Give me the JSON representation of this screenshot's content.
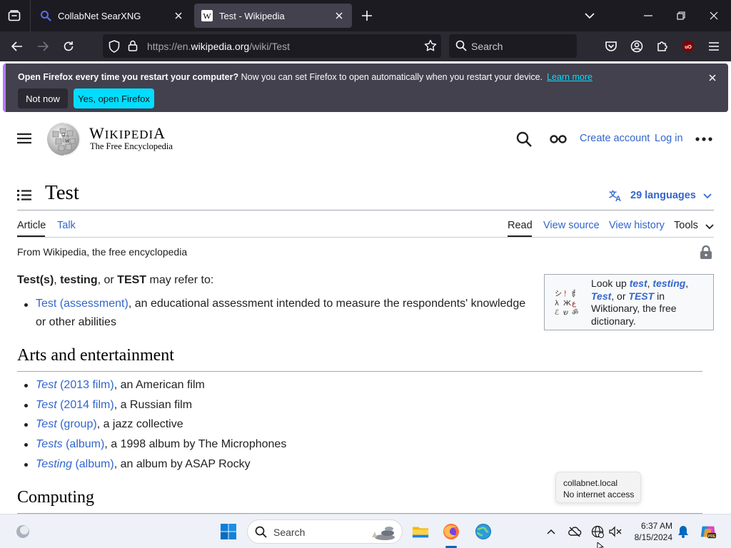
{
  "browser": {
    "tabs": [
      {
        "title": "CollabNet SearXNG",
        "active": false
      },
      {
        "title": "Test - Wikipedia",
        "active": true
      }
    ],
    "url_prefix": "https://en.",
    "url_host": "wikipedia.org",
    "url_path": "/wiki/Test",
    "search_placeholder": "Search"
  },
  "notification": {
    "bold_text": "Open Firefox every time you restart your computer?",
    "text": " Now you can set Firefox to open automatically when you restart your device.",
    "learn_more": "Learn more",
    "not_now": "Not now",
    "yes_open": "Yes, open Firefox"
  },
  "wiki": {
    "wordmark_w": "W",
    "wordmark_rest": "IKIPEDI",
    "wordmark_a": "A",
    "tagline": "The Free Encyclopedia",
    "create_account": "Create account",
    "log_in": "Log in",
    "page_title": "Test",
    "languages": "29 languages",
    "tabs": {
      "article": "Article",
      "talk": "Talk",
      "read": "Read",
      "view_source": "View source",
      "view_history": "View history",
      "tools": "Tools"
    },
    "from_text": "From Wikipedia, the free encyclopedia",
    "lead": {
      "t1": "Test(s)",
      "sep1": ", ",
      "t2": "testing",
      "sep2": ", or ",
      "t3": "TEST",
      "rest": " may refer to:"
    },
    "wiktionary": {
      "pre": "Look up ",
      "w1": "test",
      "c1": ", ",
      "w2": "testing",
      "c2": ", ",
      "w3": "Test",
      "c3": ", or ",
      "w4": "TEST",
      "post": " in Wiktionary, the free dictionary."
    },
    "intro_item": {
      "link": "Test (assessment)",
      "text": ", an educational assessment intended to measure the respondents' knowledge",
      "line2": "or other abilities"
    },
    "section1": "Arts and entertainment",
    "arts_items": [
      {
        "italic": "Test",
        "paren": " (2013 film)",
        "text": ", an American film"
      },
      {
        "italic": "Test",
        "paren": " (2014 film)",
        "text": ", a Russian film"
      },
      {
        "italic": "Test",
        "paren": " (group)",
        "text": ", a jazz collective"
      },
      {
        "italic": "Tests",
        "paren": " (album)",
        "text": ", a 1998 album by The Microphones"
      },
      {
        "italic": "Testing",
        "paren": " (album)",
        "text": ", an album by ASAP Rocky"
      }
    ],
    "section2": "Computing"
  },
  "tooltip": {
    "line1": "collabnet.local",
    "line2": "No internet access"
  },
  "taskbar": {
    "search_placeholder": "Search",
    "time": "6:37 AM",
    "date": "8/15/2024"
  }
}
